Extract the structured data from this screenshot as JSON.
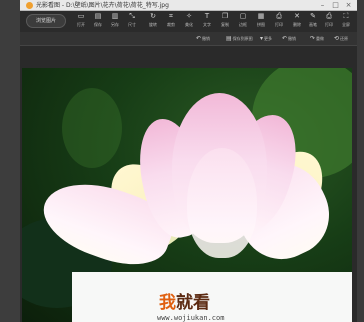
{
  "window": {
    "title": "光影看图 - D:\\壁纸\\图片\\花卉\\荷花\\荷花_特写.jpg",
    "min_glyph": "–",
    "max_glyph": "□",
    "close_glyph": "×"
  },
  "toolbar": {
    "browse_label": "浏览图片",
    "tools": [
      {
        "label": "打开",
        "icon": "folder-icon",
        "glyph": "▭"
      },
      {
        "label": "保存",
        "icon": "save-icon",
        "glyph": "▤"
      },
      {
        "label": "另存",
        "icon": "save-as-icon",
        "glyph": "▥"
      },
      {
        "label": "尺寸",
        "icon": "resize-icon",
        "glyph": "⤡"
      },
      {
        "label": "旋转",
        "icon": "rotate-icon",
        "glyph": "↻"
      },
      {
        "label": "裁剪",
        "icon": "crop-icon",
        "glyph": "⌗"
      },
      {
        "label": "美化",
        "icon": "beautify-icon",
        "glyph": "✧"
      },
      {
        "label": "文字",
        "icon": "text-icon",
        "glyph": "T"
      },
      {
        "label": "复制",
        "icon": "copy-icon",
        "glyph": "❐"
      },
      {
        "label": "边框",
        "icon": "frame-icon",
        "glyph": "▢"
      },
      {
        "label": "拼图",
        "icon": "collage-icon",
        "glyph": "▦"
      },
      {
        "label": "打印",
        "icon": "print-icon",
        "glyph": "⎙"
      },
      {
        "label": "删除",
        "icon": "delete-icon",
        "glyph": "✕"
      },
      {
        "label": "画笔",
        "icon": "pen-icon",
        "glyph": "✎"
      },
      {
        "label": "打印",
        "icon": "printer-icon",
        "glyph": "⎙"
      },
      {
        "label": "全屏",
        "icon": "fullscreen-icon",
        "glyph": "⛶"
      }
    ]
  },
  "subbar": {
    "undo_label": "撤销",
    "save_label": "保存到原图",
    "more_label": "更多",
    "back_label": "撤销",
    "redo_label": "重做",
    "restore_label": "还原"
  },
  "watermark": {
    "title_first": "我",
    "title_rest": "就看",
    "url": "www.wojiukan.com"
  },
  "colors": {
    "chrome": "#2b2b2b",
    "titlebar": "#e9e9e9",
    "watermark_accent": "#e06010",
    "watermark_brown": "#5c2a12",
    "lotus_pink": "#f2b9d8"
  }
}
